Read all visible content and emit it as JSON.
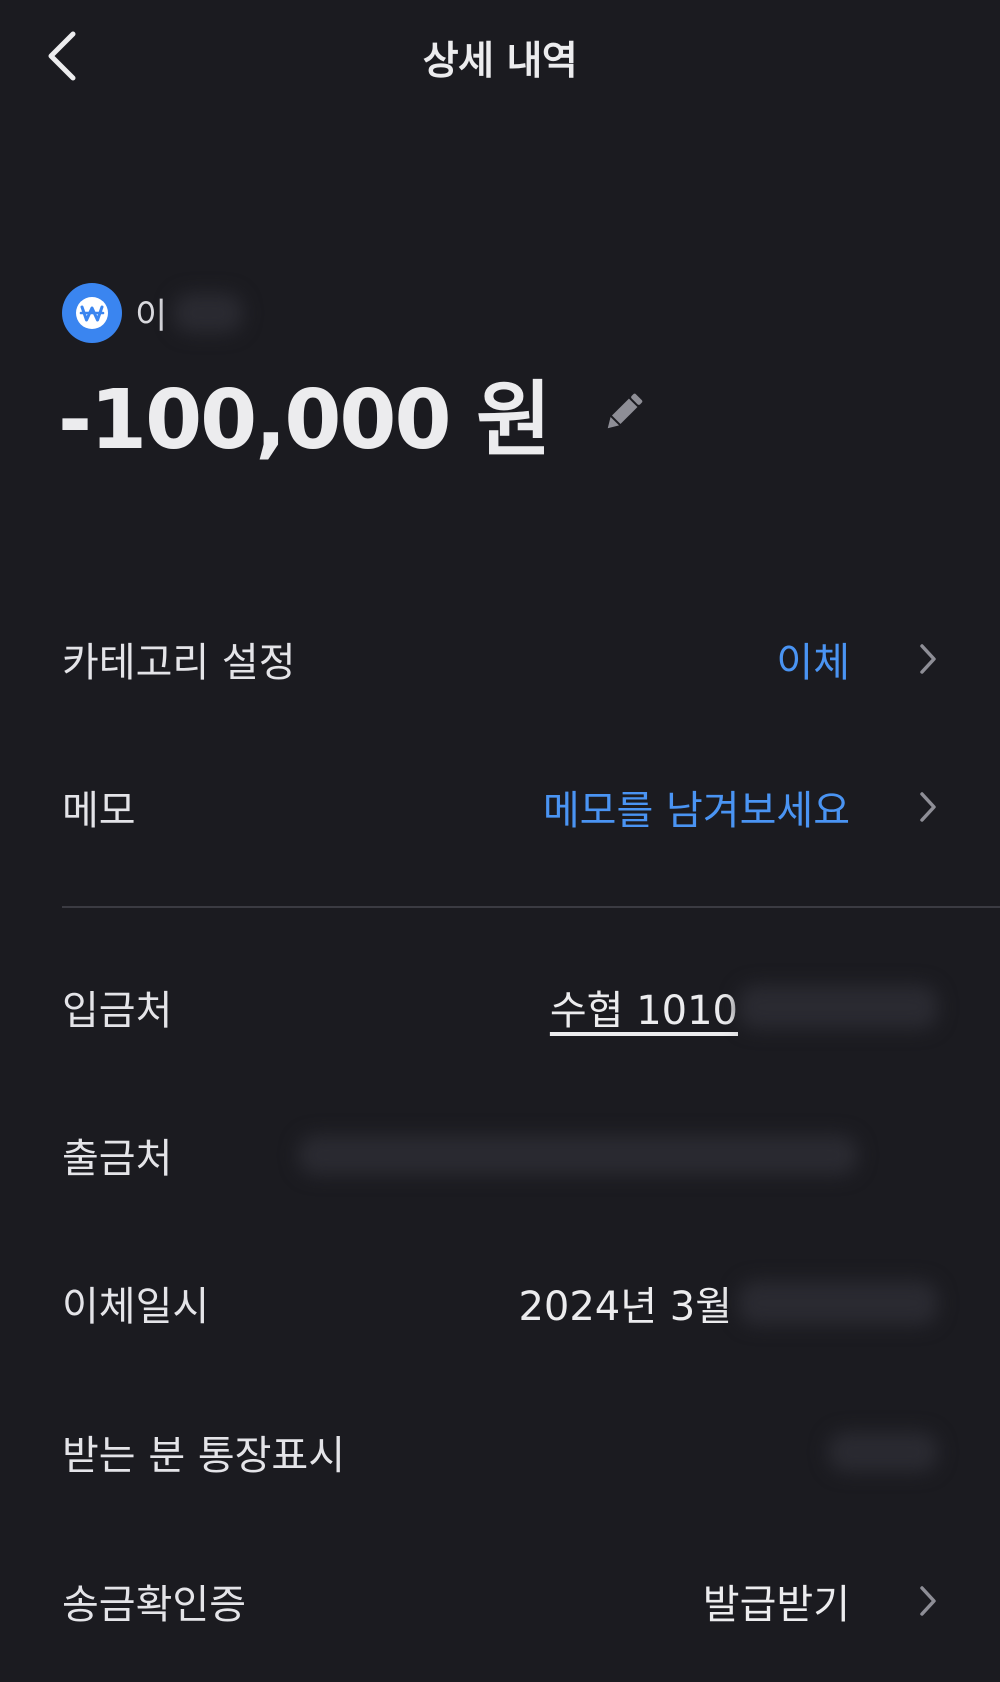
{
  "header": {
    "title": "상세 내역"
  },
  "account": {
    "name": "이",
    "badge_icon": "won-icon",
    "badge_color": "#3a85f0"
  },
  "amount": {
    "value": "-100,000 원"
  },
  "rows": {
    "category": {
      "label": "카테고리 설정",
      "value": "이체"
    },
    "memo": {
      "label": "메모",
      "value": "메모를 남겨보세요"
    },
    "deposit_to": {
      "label": "입금처",
      "value": "수협 1010"
    },
    "withdraw_from": {
      "label": "출금처",
      "value": ""
    },
    "transfer_datetime": {
      "label": "이체일시",
      "value": "2024년 3월"
    },
    "recipient_display": {
      "label": "받는 분 통장표시",
      "value": ""
    },
    "receipt": {
      "label": "송금확인증",
      "value": "발급받기"
    }
  },
  "colors": {
    "background": "#1b1b20",
    "accent": "#4a94f3",
    "divider": "#3b3b42"
  }
}
